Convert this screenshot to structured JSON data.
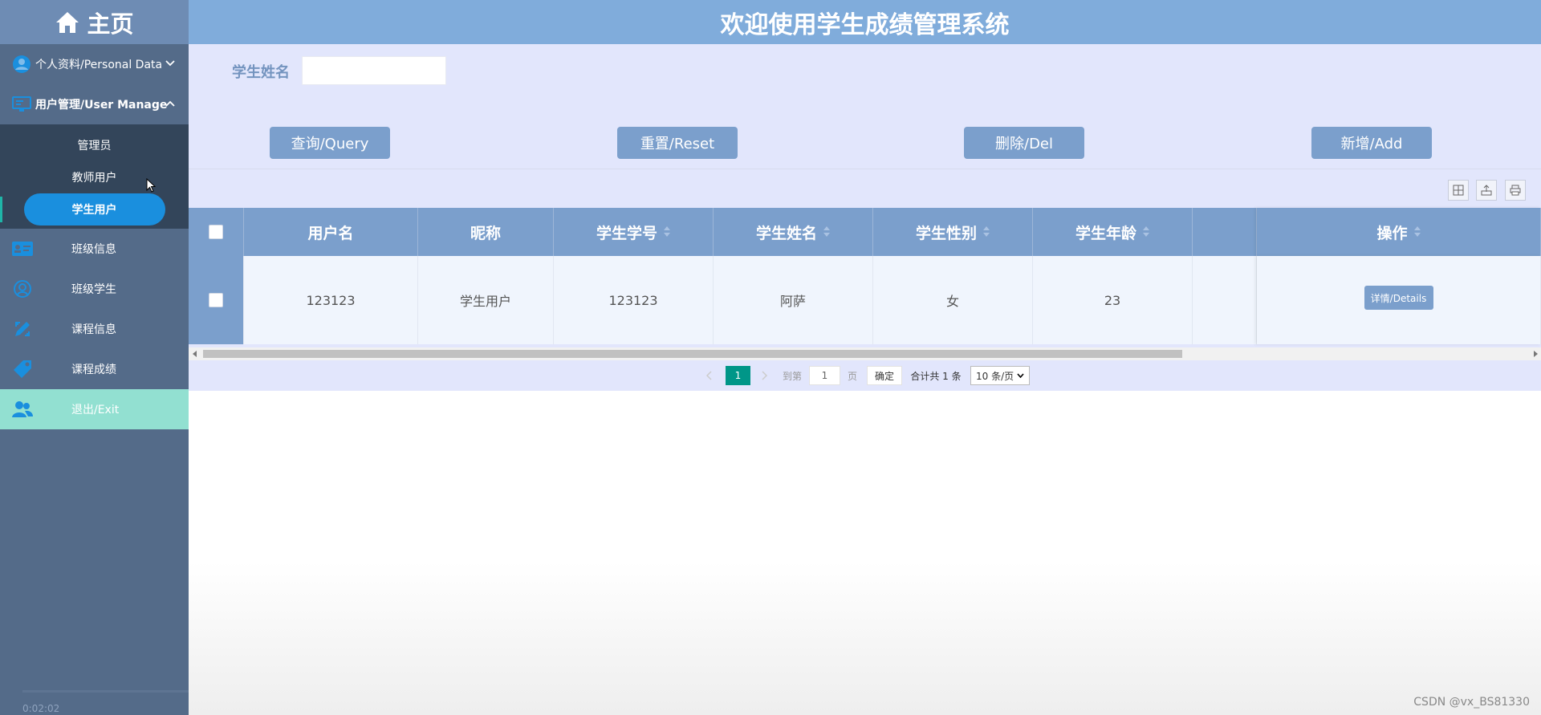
{
  "sidebar": {
    "brand": "主页",
    "groups": [
      {
        "label": "个人资料/Personal Data",
        "open": false
      },
      {
        "label": "用户管理/User Manage",
        "open": true
      }
    ],
    "subitems": [
      "管理员",
      "教师用户",
      "学生用户"
    ],
    "active_subitem": "学生用户",
    "nav": [
      {
        "label": "班级信息",
        "icon": "id-card-icon"
      },
      {
        "label": "班级学生",
        "icon": "student-group-icon"
      },
      {
        "label": "课程信息",
        "icon": "pencil-ruler-icon"
      },
      {
        "label": "课程成绩",
        "icon": "tag-icon"
      },
      {
        "label": "退出/Exit",
        "icon": "users-icon"
      }
    ],
    "timestamp": "0:02:02"
  },
  "header": {
    "title": "欢迎使用学生成绩管理系统"
  },
  "search": {
    "label": "学生姓名",
    "value": "",
    "buttons": {
      "query": "查询/Query",
      "reset": "重置/Reset",
      "delete": "删除/Del",
      "add": "新增/Add"
    }
  },
  "toolbar": {
    "icons": [
      "columns-icon",
      "export-icon",
      "print-icon"
    ]
  },
  "table": {
    "columns": [
      "用户名",
      "昵称",
      "学生学号",
      "学生姓名",
      "学生性别",
      "学生年龄",
      "",
      "操作"
    ],
    "rows": [
      {
        "username": "123123",
        "nickname": "学生用户",
        "student_no": "123123",
        "name": "阿萨",
        "gender": "女",
        "age": "23",
        "action": "详情/Details"
      }
    ]
  },
  "pagination": {
    "current_page": "1",
    "goto_prefix": "到第",
    "goto_value": "1",
    "page_suffix": "页",
    "confirm": "确定",
    "total": "合计共 1 条",
    "page_size": "10 条/页"
  },
  "watermark": "CSDN @vx_BS81330",
  "colors": {
    "sidebar": "#546b89",
    "header": "#80acdb",
    "panel": "#e2e6fc",
    "button": "#7b9fcc",
    "active": "#1a8fde",
    "exit": "#92e0d1",
    "page_current": "#009688"
  }
}
